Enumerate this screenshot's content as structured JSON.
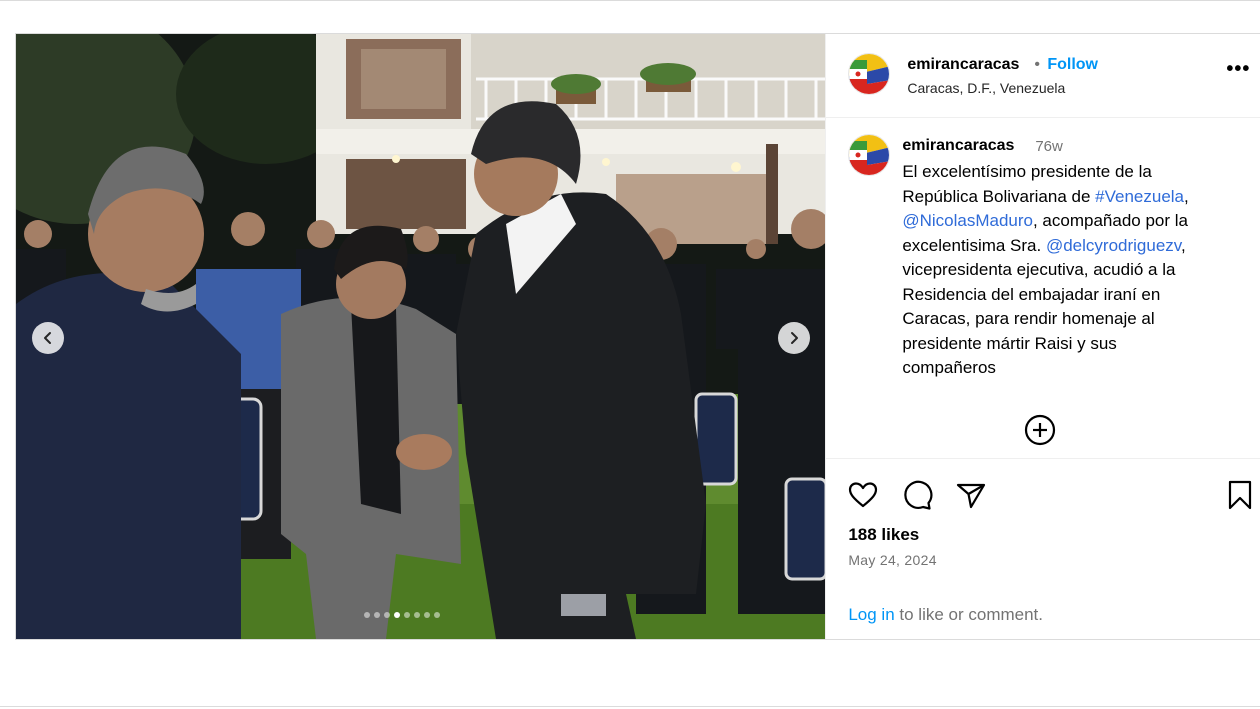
{
  "post": {
    "username": "emirancaracas",
    "separator": "•",
    "follow_label": "Follow",
    "location": "Caracas, D.F., Venezuela",
    "more_label": "•••",
    "caption": {
      "username": "emirancaracas",
      "time": "76w",
      "lines": [
        [
          {
            "text": "El excelentísimo presidente de la"
          }
        ],
        [
          {
            "text": "República Bolivariana de "
          },
          {
            "text": "#Venezuela",
            "link": true
          },
          {
            "text": ","
          }
        ],
        [
          {
            "text": "@NicolasMaduro",
            "link": true
          },
          {
            "text": ", acompañado por la"
          }
        ],
        [
          {
            "text": "excelentisima Sra. "
          },
          {
            "text": "@delcyrodriguezv",
            "link": true
          },
          {
            "text": ","
          }
        ],
        [
          {
            "text": "vicepresidenta ejecutiva, acudió a la"
          }
        ],
        [
          {
            "text": "Residencia del embajadar iraní en"
          }
        ],
        [
          {
            "text": "Caracas,  para rendir homenaje al"
          }
        ],
        [
          {
            "text": "presidente mártir Raisi y sus"
          }
        ],
        [
          {
            "text": "compañeros"
          }
        ]
      ]
    },
    "likes": "188 likes",
    "date": "May 24, 2024",
    "login_link": "Log in",
    "login_rest": " to like or comment.",
    "carousel": {
      "count": 8,
      "active_index": 3
    },
    "icons": {
      "prev": "chevron-left-icon",
      "next": "chevron-right-icon",
      "like": "heart-icon",
      "comment": "comment-bubble-icon",
      "share": "paper-plane-icon",
      "save": "bookmark-icon",
      "more_comments": "plus-circle-icon"
    },
    "colors": {
      "link": "#0095f6",
      "mention": "#2f6bd8",
      "muted": "#737373"
    }
  }
}
